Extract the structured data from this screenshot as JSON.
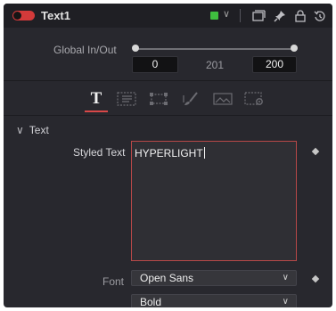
{
  "header": {
    "title": "Text1",
    "color_swatch": "#3fbf3f",
    "icons": [
      "toggle-icon",
      "color-chevron-icon",
      "window-icon",
      "pin-icon",
      "lock-icon",
      "reset-icon"
    ]
  },
  "global_in_out": {
    "label": "Global In/Out",
    "in_value": "0",
    "duration": "201",
    "out_value": "200"
  },
  "tabs": [
    {
      "name": "text",
      "icon": "text-tool-icon",
      "active": true,
      "label": "T"
    },
    {
      "name": "layout",
      "icon": "layout-icon",
      "active": false
    },
    {
      "name": "transform",
      "icon": "transform-icon",
      "active": false
    },
    {
      "name": "shading",
      "icon": "brush-icon",
      "active": false
    },
    {
      "name": "image",
      "icon": "image-icon",
      "active": false
    },
    {
      "name": "settings",
      "icon": "settings-icon",
      "active": false
    }
  ],
  "section": {
    "title": "Text"
  },
  "styled_text": {
    "label": "Styled Text",
    "value": "HYPERLIGHT"
  },
  "font": {
    "label": "Font",
    "family": "Open Sans",
    "style": "Bold"
  },
  "colors": {
    "accent": "#d84848",
    "panel_bg": "#28282e",
    "header_bg": "#1f1f24"
  }
}
